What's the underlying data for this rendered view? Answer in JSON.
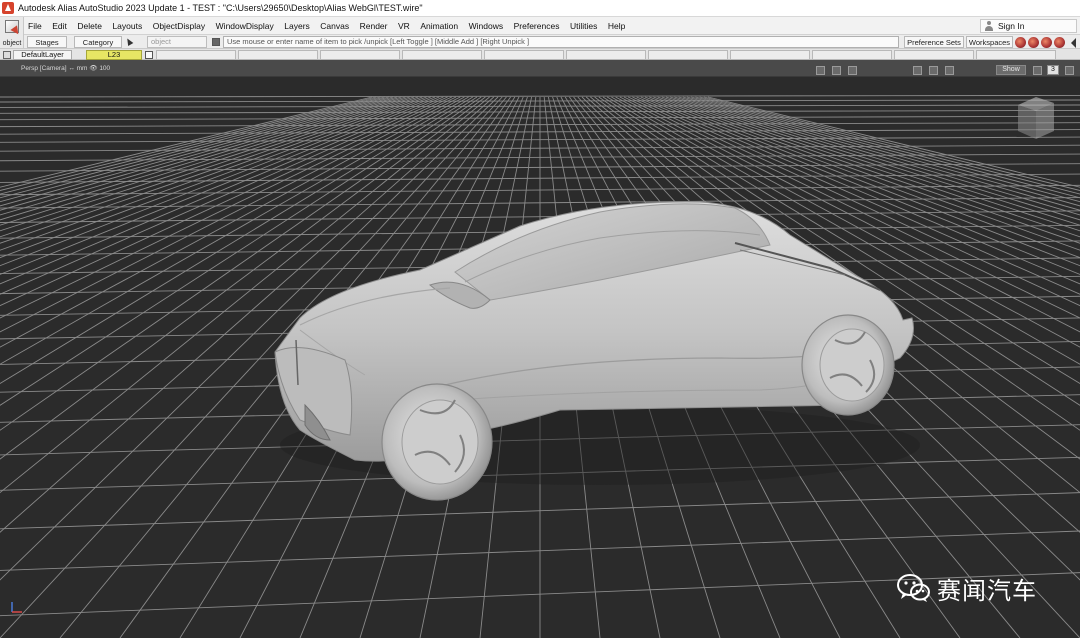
{
  "window": {
    "title": "Autodesk Alias AutoStudio 2023 Update 1    - TEST : \"C:\\Users\\29650\\Desktop\\Alias WebGl\\TEST.wire\""
  },
  "menu": {
    "items": [
      "File",
      "Edit",
      "Delete",
      "Layouts",
      "ObjectDisplay",
      "WindowDisplay",
      "Layers",
      "Canvas",
      "Render",
      "VR",
      "Animation",
      "Windows",
      "Preferences",
      "Utilities",
      "Help"
    ],
    "signin_label": "Sign In"
  },
  "tool": {
    "label": "object"
  },
  "command": {
    "stages_label": "Stages",
    "category_label": "Category",
    "object_placeholder": "object",
    "prompt": "Use mouse or enter name of item to pick /unpick  [Left Toggle ] [Middle Add ] [Right Unpick ]",
    "preference_sets_label": "Preference Sets",
    "workspaces_label": "Workspaces"
  },
  "layers": {
    "default_label": "DefaultLayer",
    "active_label": "L23",
    "active_color": "#e7e664"
  },
  "viewport": {
    "label": "Persp [Camera]  ↔ mm   👁 100",
    "show_label": "Show",
    "window_number": "3",
    "background_color": "#2b2b2b",
    "grid_color": "#8a8a8a",
    "model_color": "#c8c8c8"
  },
  "watermark": {
    "text": "赛闻汽车",
    "icon": "wechat-icon"
  }
}
